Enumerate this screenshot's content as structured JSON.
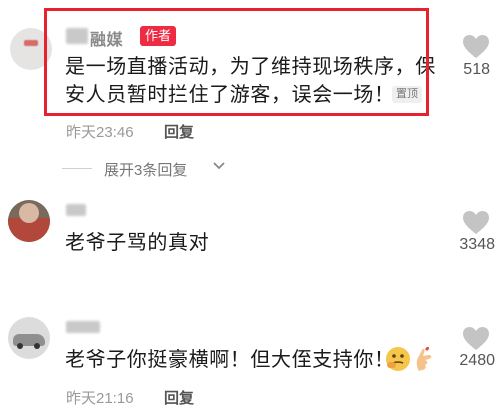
{
  "comments": [
    {
      "username": "融媒",
      "badge": "作者",
      "text_line1": "是一场直播活动，为了维持现场秩序，保",
      "text_line2": "安人员暂时拦住了游客，误会一场！",
      "pinned": "置顶",
      "time": "昨天23:46",
      "reply": "回复",
      "likes": "518"
    },
    {
      "text": "老爷子骂的真对",
      "likes": "3348"
    },
    {
      "text": "老爷子你挺豪横啊！但大侄支持你！",
      "time": "昨天21:16",
      "reply": "回复",
      "likes": "2480"
    }
  ],
  "expand_replies": "展开3条回复",
  "colors": {
    "highlight": "#e8212e",
    "badge": "#ef2b44",
    "text": "#1a1a1a",
    "meta": "#9a9a9a"
  }
}
